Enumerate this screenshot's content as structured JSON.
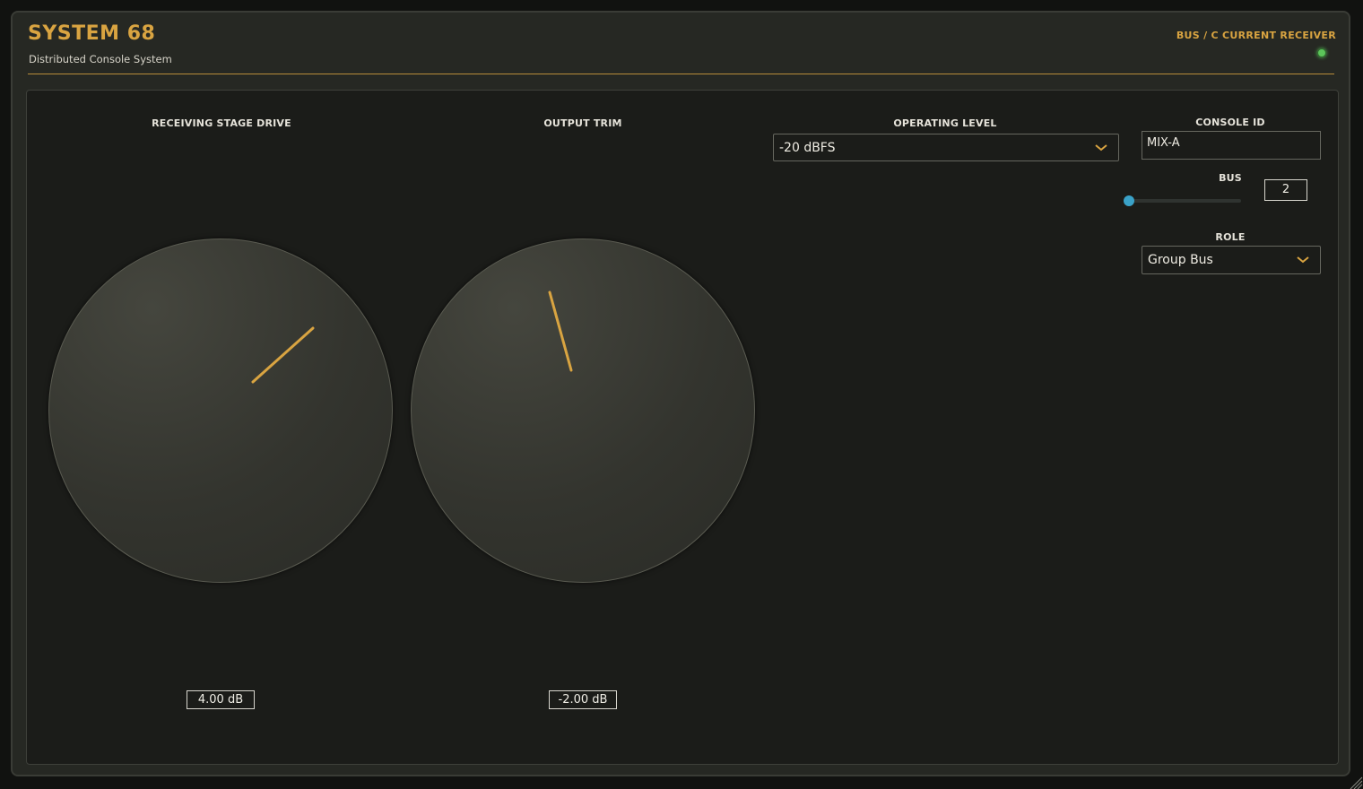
{
  "header": {
    "title": "SYSTEM 68",
    "subtitle": "Distributed Console System",
    "mode_label": "BUS / C CURRENT RECEIVER",
    "status_color": "#5cc45a"
  },
  "controls": {
    "drive": {
      "label": "RECEIVING STAGE DRIVE",
      "value": "4.00 dB"
    },
    "trim": {
      "label": "OUTPUT TRIM",
      "value": "-2.00 dB"
    },
    "operating_level": {
      "label": "OPERATING LEVEL",
      "selected": "-20 dBFS"
    },
    "console_id": {
      "label": "CONSOLE ID",
      "value": "MIX-A"
    },
    "bus": {
      "label": "BUS",
      "value": "2",
      "slider_fraction": 0.0
    },
    "role": {
      "label": "ROLE",
      "selected": "Group Bus"
    }
  },
  "colors": {
    "accent": "#d9a441",
    "slider": "#3aa2c8",
    "panel": "#1b1c19"
  },
  "icons": [
    "chevron-down-icon",
    "resize-grip-icon",
    "status-led"
  ]
}
